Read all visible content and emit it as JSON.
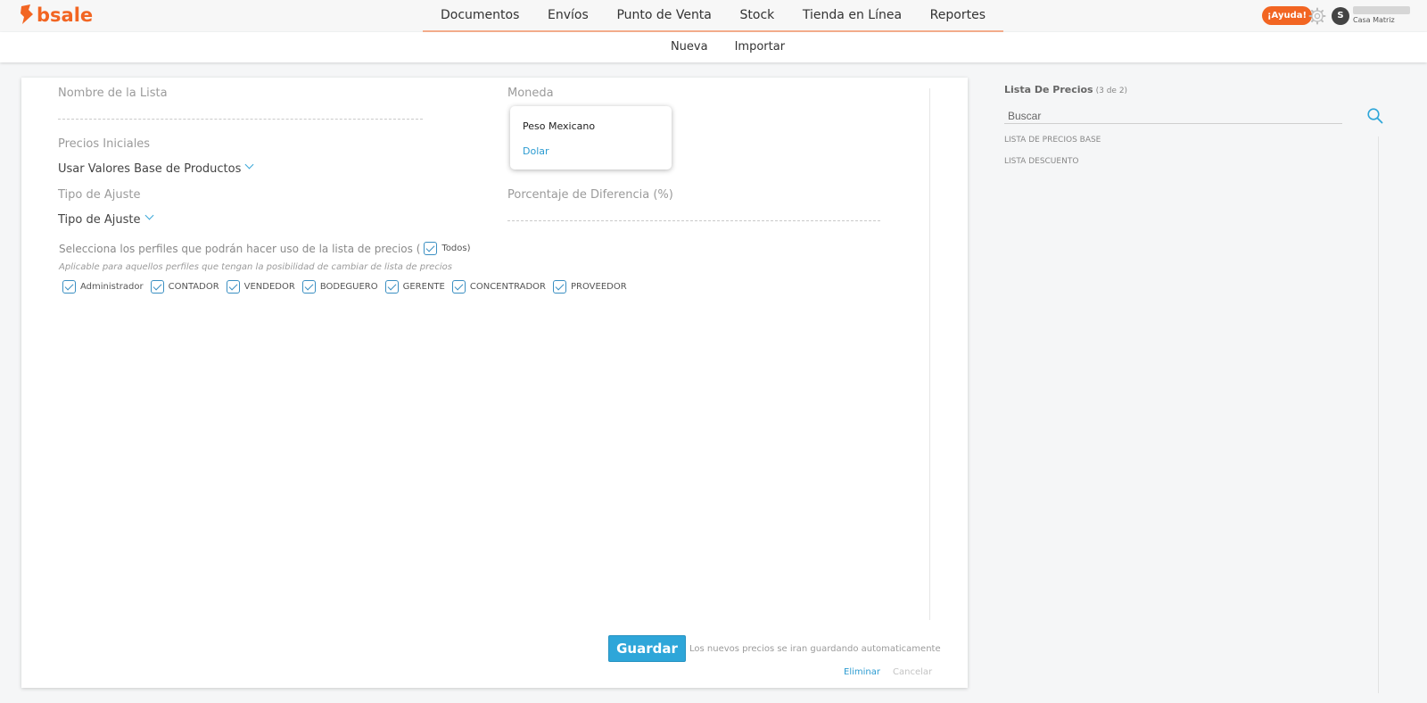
{
  "brand": {
    "name": "bsale",
    "color": "#f26522"
  },
  "nav": {
    "items": [
      "Documentos",
      "Envíos",
      "Punto de Venta",
      "Stock",
      "Tienda en Línea",
      "Reportes"
    ]
  },
  "header": {
    "help_label": "¡Ayuda!",
    "avatar_initial": "S",
    "company": "Casa Matriz",
    "settings_icon": "gear-icon"
  },
  "subnav": {
    "items": [
      "Nueva",
      "Importar"
    ]
  },
  "form": {
    "name_label": "Nombre de la Lista",
    "currency_label": "Moneda",
    "currency_options": [
      "Peso Mexicano",
      "Dolar"
    ],
    "initial_prices_label": "Precios Iniciales",
    "initial_prices_value": "Usar Valores Base de Productos",
    "adjust_type_label": "Tipo de Ajuste",
    "adjust_type_value": "Tipo de Ajuste",
    "percentage_label": "Porcentaje de Diferencia (%)",
    "profiles_title": "Selecciona los perfiles que podrán hacer uso de la lista de precios (",
    "profiles_all_label": "Todos)",
    "profiles_note": "Aplicable para aquellos perfiles que tengan la posibilidad de cambiar de lista de precios",
    "profiles": [
      "Administrador",
      "CONTADOR",
      "VENDEDOR",
      "BODEGUERO",
      "GERENTE",
      "CONCENTRADOR",
      "PROVEEDOR"
    ],
    "save_label": "Guardar",
    "autosave_note": "Los nuevos precios se iran guardando automaticamente",
    "delete_label": "Eliminar",
    "cancel_label": "Cancelar"
  },
  "sidebar": {
    "title": "Lista De Precios",
    "count": "(3 de 2)",
    "search_placeholder": "Buscar",
    "items": [
      "LISTA DE PRECIOS BASE",
      "LISTA DESCUENTO"
    ]
  },
  "colors": {
    "accent": "#2ea6d9",
    "link": "#2b9bd1",
    "brand": "#f26522"
  }
}
